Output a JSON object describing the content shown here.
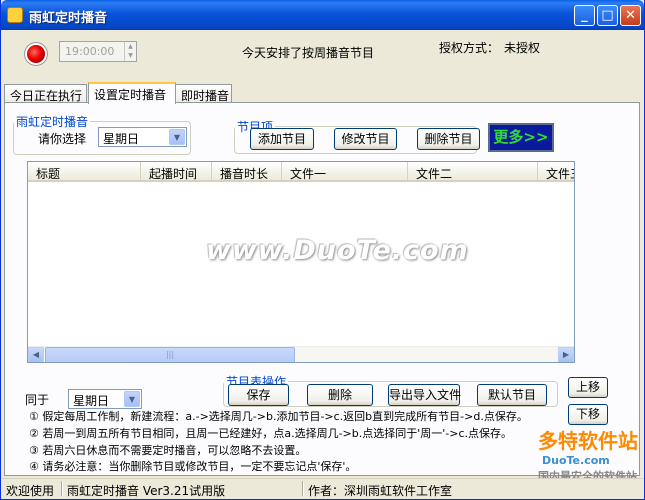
{
  "window": {
    "title": "雨虹定时播音"
  },
  "titlebar_buttons": {
    "minimize": "_",
    "maximize": "□",
    "close": "✕"
  },
  "top": {
    "time_value": "19:00:00",
    "today_text": "今天安排了按周播音节目",
    "auth_label": "授权方式：",
    "auth_value": "未授权"
  },
  "tabs": [
    {
      "label": "今日正在执行"
    },
    {
      "label": "设置定时播音"
    },
    {
      "label": "即时播音"
    }
  ],
  "timed_group": {
    "legend": "雨虹定时播音",
    "select_label": "请你选择",
    "select_value": "星期日"
  },
  "program_group": {
    "legend": "节目项",
    "add": "添加节目",
    "edit": "修改节目",
    "delete": "删除节目",
    "more": "更多>>"
  },
  "table": {
    "columns": [
      "标题",
      "起播时间",
      "播音时长",
      "文件一",
      "文件二",
      "文件三"
    ],
    "rows": []
  },
  "watermark": "www.DuoTe.com",
  "same_as": {
    "label": "同于",
    "value": "星期日"
  },
  "table_ops": {
    "legend": "节目表操作",
    "save": "保存",
    "delete": "删除",
    "export_import": "导出导入文件",
    "default": "默认节目"
  },
  "move": {
    "up": "上移",
    "down": "下移"
  },
  "notes": [
    "① 假定每周工作制，新建流程：a.->选择周几->b.添加节目->c.返回b直到完成所有节目->d.点保存。",
    "② 若周一到周五所有节目相同，且周一已经建好，点a.选择周几->b.点选择同于'周一'->c.点保存。",
    "③ 若周六日休息而不需要定时播音，可以忽略不去设置。",
    "④ 请务必注意：当你删除节目或修改节目，一定不要忘记点'保存'。"
  ],
  "status": {
    "welcome": "欢迎使用",
    "version": "雨虹定时播音 Ver3.21试用版",
    "author": "作者：深圳雨虹软件工作室"
  },
  "brand_watermark": {
    "text": "多特软件站",
    "sub": "DuoTe.com",
    "tagline": "国内最安全的软件站"
  },
  "colors": {
    "title_bar": "#0a53d8",
    "more_bg": "#0a1a9c",
    "more_text": "#33dd33",
    "legend": "#0046d5"
  }
}
